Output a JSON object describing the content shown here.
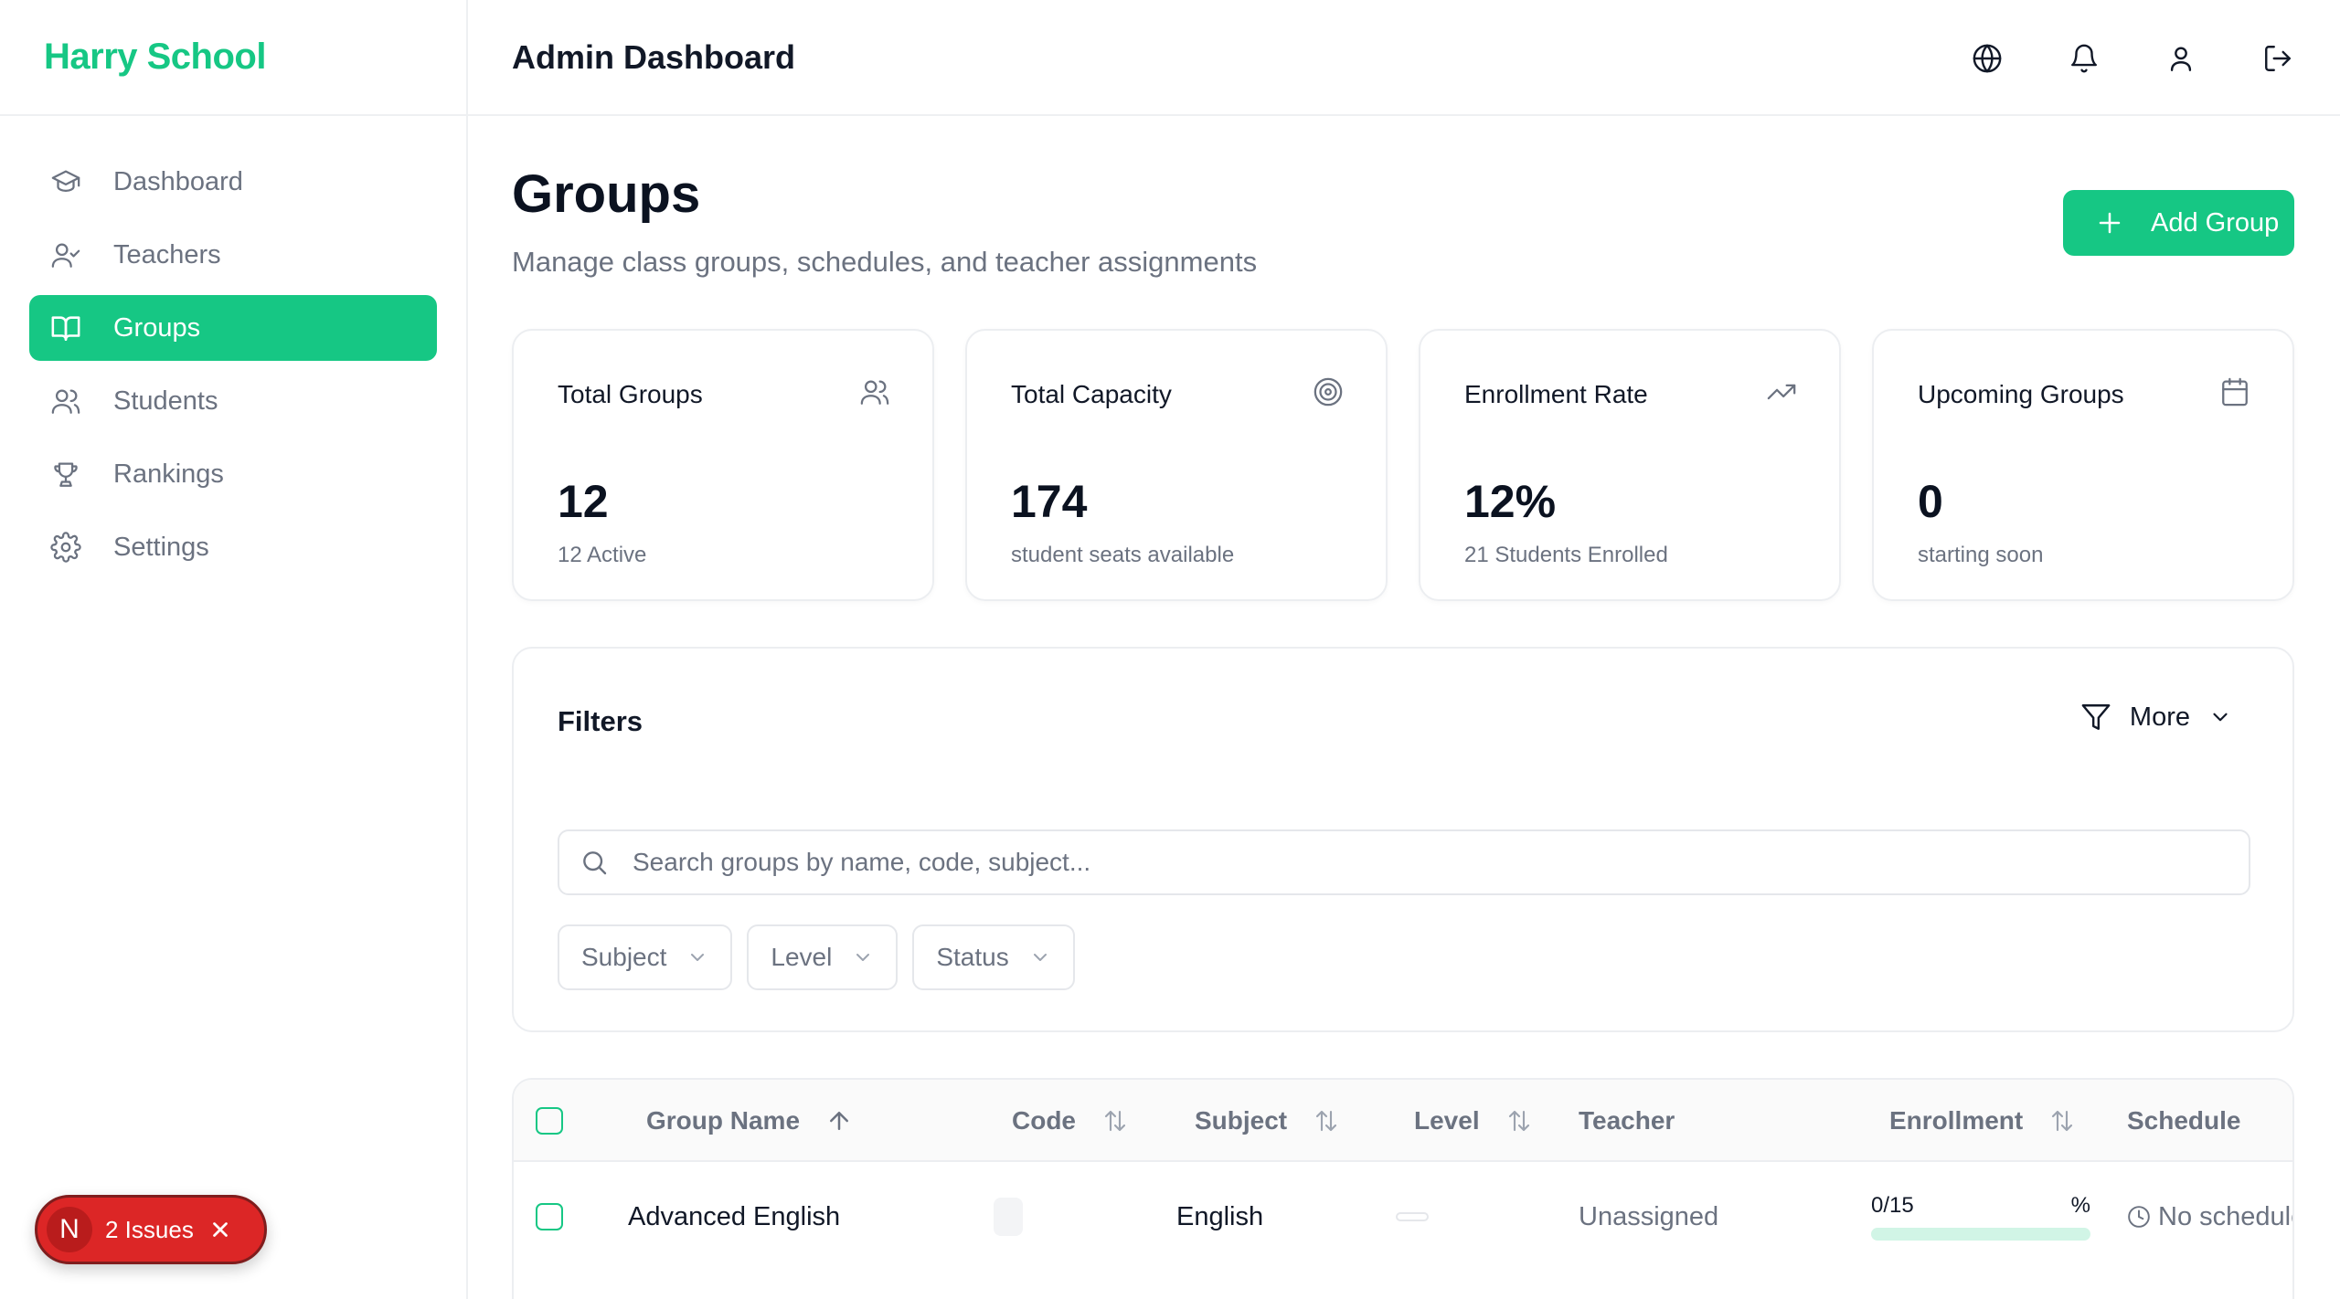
{
  "brand": {
    "name": "Harry School"
  },
  "header": {
    "title": "Admin Dashboard"
  },
  "sidebar": {
    "items": [
      {
        "label": "Dashboard",
        "icon": "graduation-cap-icon"
      },
      {
        "label": "Teachers",
        "icon": "user-check-icon"
      },
      {
        "label": "Groups",
        "icon": "book-open-icon",
        "active": true
      },
      {
        "label": "Students",
        "icon": "users-icon"
      },
      {
        "label": "Rankings",
        "icon": "trophy-icon"
      },
      {
        "label": "Settings",
        "icon": "gear-icon"
      }
    ]
  },
  "page": {
    "title": "Groups",
    "subtitle": "Manage class groups, schedules, and teacher assignments",
    "add_button": "Add Group"
  },
  "stats": [
    {
      "label": "Total Groups",
      "value": "12",
      "desc": "12 Active",
      "icon": "users-icon"
    },
    {
      "label": "Total Capacity",
      "value": "174",
      "desc": "student seats available",
      "icon": "target-icon"
    },
    {
      "label": "Enrollment Rate",
      "value": "12%",
      "desc": "21 Students Enrolled",
      "icon": "trending-up-icon"
    },
    {
      "label": "Upcoming Groups",
      "value": "0",
      "desc": "starting soon",
      "icon": "calendar-icon"
    }
  ],
  "filters": {
    "title": "Filters",
    "more": "More",
    "search_placeholder": "Search groups by name, code, subject...",
    "selects": [
      "Subject",
      "Level",
      "Status"
    ]
  },
  "table": {
    "columns": [
      "Group Name",
      "Code",
      "Subject",
      "Level",
      "Teacher",
      "Enrollment",
      "Schedule"
    ],
    "rows": [
      {
        "name": "Advanced English",
        "code": "",
        "subject": "English",
        "level": "",
        "teacher": "Unassigned",
        "enrollment": "0/15",
        "enrollment_pct_label": "%",
        "enrollment_fraction": 0,
        "schedule": "No schedule"
      }
    ]
  },
  "issues_badge": {
    "letter": "N",
    "label": "2 Issues"
  },
  "colors": {
    "accent": "#16c784",
    "danger": "#dc2626"
  }
}
